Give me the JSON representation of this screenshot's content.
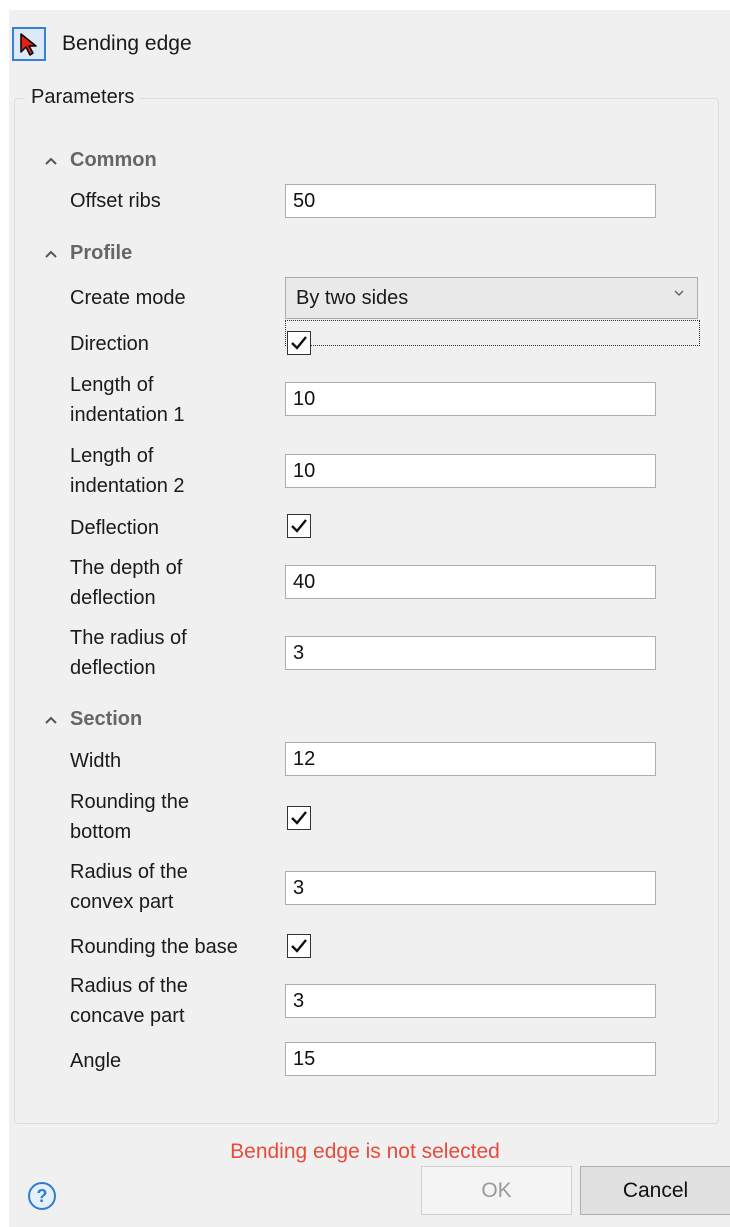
{
  "header": {
    "title": "Bending edge",
    "icon": "select-pointer-icon"
  },
  "group_title": "Parameters",
  "sections": {
    "common": {
      "title": "Common"
    },
    "profile": {
      "title": "Profile"
    },
    "section": {
      "title": "Section"
    }
  },
  "fields": {
    "offset_ribs": {
      "label": "Offset ribs",
      "value": "50"
    },
    "create_mode": {
      "label": "Create mode",
      "value": "By two sides"
    },
    "direction": {
      "label": "Direction",
      "checked": true
    },
    "indent1": {
      "label_line1": "Length of",
      "label_line2": "indentation 1",
      "value": "10"
    },
    "indent2": {
      "label_line1": "Length of",
      "label_line2": "indentation 2",
      "value": "10"
    },
    "deflection": {
      "label": "Deflection",
      "checked": true
    },
    "depth": {
      "label_line1": "The depth of",
      "label_line2": "deflection",
      "value": "40"
    },
    "radius_defl": {
      "label_line1": "The radius of",
      "label_line2": "deflection",
      "value": "3"
    },
    "width": {
      "label": "Width",
      "value": "12"
    },
    "round_bottom": {
      "label_line1": "Rounding the",
      "label_line2": "bottom",
      "checked": true
    },
    "radius_convex": {
      "label_line1": "Radius of the",
      "label_line2": "convex part",
      "value": "3"
    },
    "round_base": {
      "label": "Rounding the base",
      "checked": true
    },
    "radius_concave": {
      "label_line1": "Radius of the",
      "label_line2": "concave part",
      "value": "3"
    },
    "angle": {
      "label": "Angle",
      "value": "15"
    }
  },
  "status_message": "Bending edge is not selected",
  "buttons": {
    "help": "?",
    "ok": "OK",
    "cancel": "Cancel"
  },
  "colors": {
    "status": "#e84a3c",
    "accent": "#3a7fd0"
  }
}
